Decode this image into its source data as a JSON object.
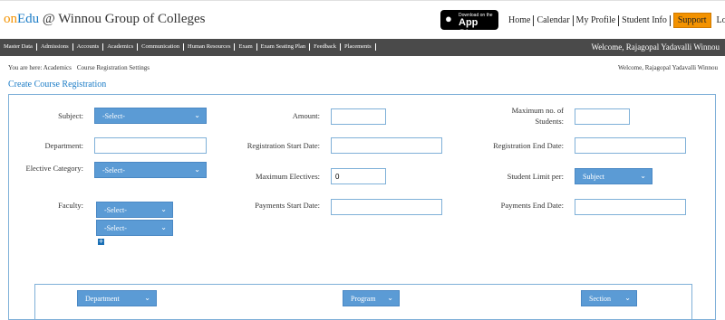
{
  "brand": {
    "on": "on",
    "edu": "Edu",
    "rest": " @ Winnou Group of Colleges"
  },
  "appstore": {
    "small": "Download on the",
    "big": "App Store"
  },
  "top_links": [
    "Home",
    "Calendar",
    "My Profile",
    "Student Info"
  ],
  "support_label": "Support",
  "logout_label": "Log Out",
  "nav_items": [
    "Master Data",
    "Admissions",
    "Accounts",
    "Academics",
    "Communication",
    "Human Resources",
    "Exam",
    "Exam Seating Plan",
    "Feedback",
    "Placements"
  ],
  "welcome": "Welcome, Rajagopal Yadavalli Winnou",
  "breadcrumb": {
    "prefix": "You are here: Academics",
    "current": "Course Registration Settings"
  },
  "page_title": "Create Course Registration",
  "form": {
    "subject_label": "Subject:",
    "subject_value": "-Select-",
    "amount_label": "Amount:",
    "amount_value": "",
    "max_students_label_1": "Maximum no. of",
    "max_students_label_2": "Students:",
    "max_students_value": "",
    "department_label": "Department:",
    "department_value": "",
    "reg_start_label": "Registration Start Date:",
    "reg_start_value": "",
    "reg_end_label": "Registration End Date:",
    "reg_end_value": "",
    "elective_label": "Elective Category:",
    "elective_value": "-Select-",
    "max_electives_label": "Maximum Electives:",
    "max_electives_value": "0",
    "student_limit_label": "Student Limit per:",
    "student_limit_value": "Subject",
    "faculty_label": "Faculty:",
    "faculty_value_1": "-Select-",
    "faculty_value_2": "-Select-",
    "pay_start_label": "Payments Start Date:",
    "pay_start_value": "",
    "pay_end_label": "Payments End Date:",
    "pay_end_value": ""
  },
  "filters": {
    "department": "Department",
    "program": "Program",
    "section": "Section"
  }
}
